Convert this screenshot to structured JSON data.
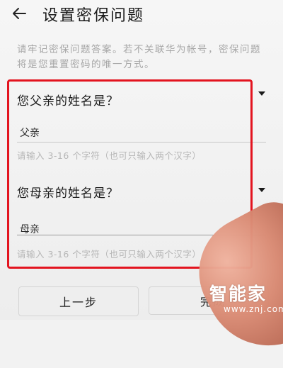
{
  "header": {
    "title": "设置密保问题",
    "back_icon": "back-arrow-icon"
  },
  "hint": "请牢记密保问题答案。若不关联华为帐号，密保问题将是您重置密码的唯一方式。",
  "questions": [
    {
      "question": "您父亲的姓名是？",
      "answer": "父亲",
      "input_hint": "请输入 3-16 个字符（也可只输入两个汉字）"
    },
    {
      "question": "您母亲的姓名是？",
      "answer": "母亲",
      "input_hint": "请输入 3-16 个字符（也可只输入两个汉字）"
    }
  ],
  "buttons": {
    "prev": "上一步",
    "done": "完成"
  },
  "watermark": {
    "logo": "智能家",
    "url": "www.znj.com"
  },
  "colors": {
    "highlight": "#e3141f",
    "hint_text": "#a7a7a7",
    "background": "#f2f2f2"
  }
}
